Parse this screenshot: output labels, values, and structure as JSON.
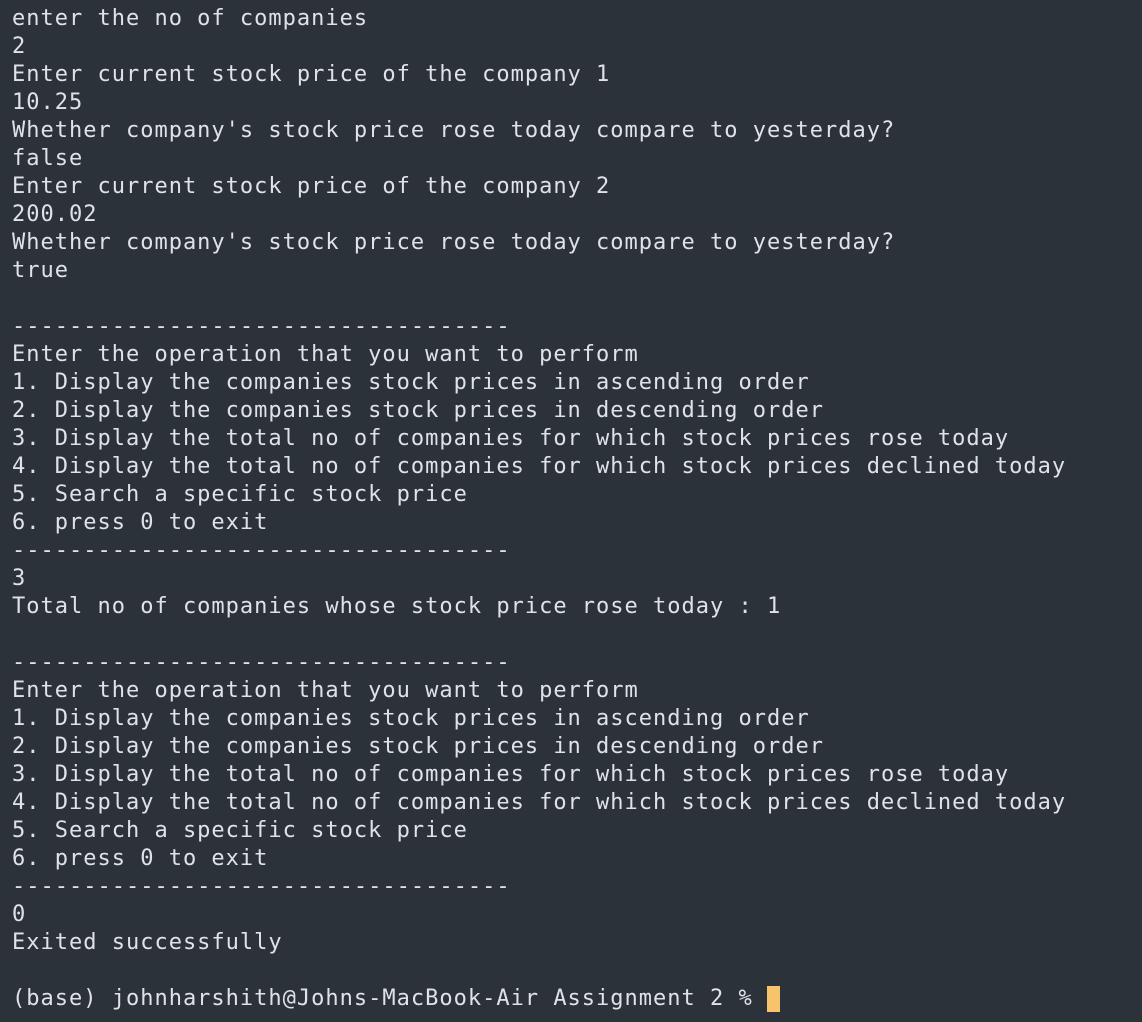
{
  "terminal": {
    "lines": [
      "enter the no of companies",
      "2",
      "Enter current stock price of the company 1",
      "10.25",
      "Whether company's stock price rose today compare to yesterday?",
      "false",
      "Enter current stock price of the company 2",
      "200.02",
      "Whether company's stock price rose today compare to yesterday?",
      "true",
      "",
      "-----------------------------------",
      "Enter the operation that you want to perform",
      "1. Display the companies stock prices in ascending order",
      "2. Display the companies stock prices in descending order",
      "3. Display the total no of companies for which stock prices rose today",
      "4. Display the total no of companies for which stock prices declined today",
      "5. Search a specific stock price",
      "6. press 0 to exit",
      "-----------------------------------",
      "3",
      "Total no of companies whose stock price rose today : 1",
      "",
      "-----------------------------------",
      "Enter the operation that you want to perform",
      "1. Display the companies stock prices in ascending order",
      "2. Display the companies stock prices in descending order",
      "3. Display the total no of companies for which stock prices rose today",
      "4. Display the total no of companies for which stock prices declined today",
      "5. Search a specific stock price",
      "6. press 0 to exit",
      "-----------------------------------",
      "0",
      "Exited successfully",
      ""
    ],
    "prompt": "(base) johnharshith@Johns-MacBook-Air Assignment 2 %"
  },
  "colors": {
    "background": "#2b323a",
    "text": "#dfe3e8",
    "cursor": "#f7c46c"
  }
}
